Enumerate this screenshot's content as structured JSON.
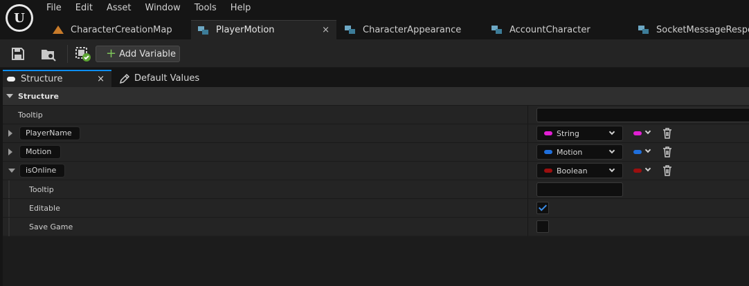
{
  "app": {
    "logo_text": "U"
  },
  "menu": [
    "File",
    "Edit",
    "Asset",
    "Window",
    "Tools",
    "Help"
  ],
  "document_tabs": [
    {
      "label": "CharacterCreationMap",
      "icon": "map-icon",
      "active": false
    },
    {
      "label": "PlayerMotion",
      "icon": "struct-icon",
      "active": true,
      "close": "×"
    },
    {
      "label": "CharacterAppearance",
      "icon": "struct-icon",
      "active": false
    },
    {
      "label": "AccountCharacter",
      "icon": "struct-icon",
      "active": false
    },
    {
      "label": "SocketMessageRespon",
      "icon": "struct-icon",
      "active": false
    }
  ],
  "toolbar": {
    "add_variable_label": "Add Variable",
    "add_icon": "+"
  },
  "panel_tabs": {
    "structure": {
      "label": "Structure",
      "close": "×"
    },
    "default_values": {
      "label": "Default Values"
    }
  },
  "details": {
    "category": "Structure",
    "tooltip_label": "Tooltip",
    "variables": [
      {
        "name": "PlayerName",
        "type": "String",
        "color": "#e21fd3",
        "expanded": false
      },
      {
        "name": "Motion",
        "type": "Motion",
        "color": "#1f6fdc",
        "expanded": false
      },
      {
        "name": "isOnline",
        "type": "Boolean",
        "color": "#9c0f0f",
        "expanded": true
      }
    ],
    "sub_rows": {
      "tooltip_label": "Tooltip",
      "editable_label": "Editable",
      "editable_checked": true,
      "save_game_label": "Save Game",
      "save_game_checked": false
    }
  },
  "colors": {
    "accent": "#0d8ef2",
    "check": "#3b8eea",
    "add_green": "#7ec55a"
  }
}
